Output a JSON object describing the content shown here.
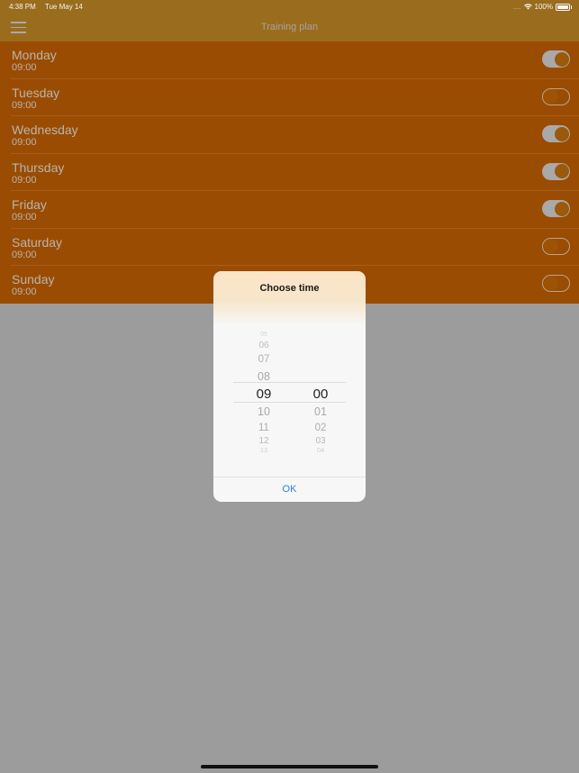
{
  "status_bar": {
    "time": "4:38 PM",
    "date": "Tue May 14",
    "signal": "....",
    "battery": "100%"
  },
  "navbar": {
    "title": "Training plan",
    "menu_icon": "hamburger-menu-icon"
  },
  "days": [
    {
      "name": "Monday",
      "time": "09:00",
      "enabled": true
    },
    {
      "name": "Tuesday",
      "time": "09:00",
      "enabled": false
    },
    {
      "name": "Wednesday",
      "time": "09:00",
      "enabled": true
    },
    {
      "name": "Thursday",
      "time": "09:00",
      "enabled": true
    },
    {
      "name": "Friday",
      "time": "09:00",
      "enabled": true
    },
    {
      "name": "Saturday",
      "time": "09:00",
      "enabled": false
    },
    {
      "name": "Sunday",
      "time": "09:00",
      "enabled": false
    }
  ],
  "dialog": {
    "title": "Choose time",
    "hours": [
      "05",
      "06",
      "07",
      "08",
      "09",
      "10",
      "11",
      "12",
      "13"
    ],
    "minutes": [
      "00",
      "01",
      "02",
      "03",
      "04"
    ],
    "selected_hour": "09",
    "selected_minute": "00",
    "ok_label": "OK"
  }
}
